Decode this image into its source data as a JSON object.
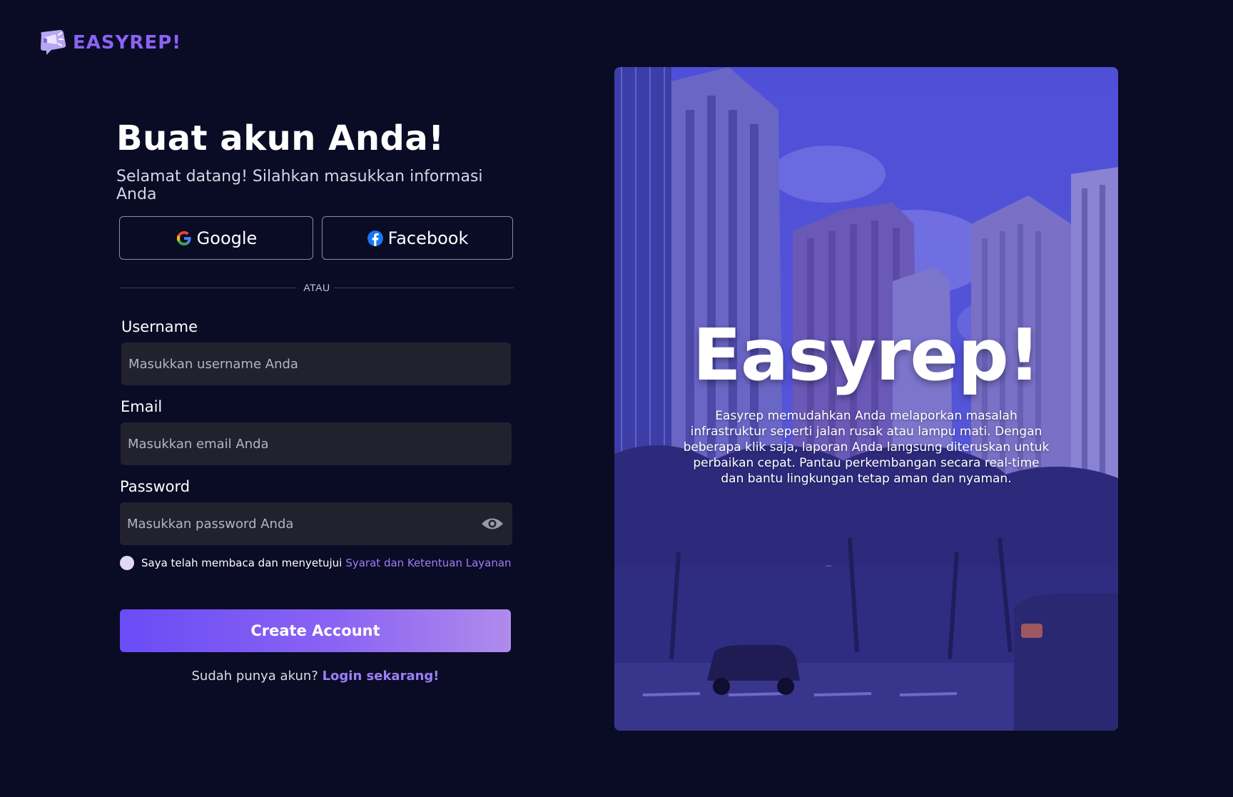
{
  "brand": {
    "name": "EASYREP!",
    "color": "#8a63f3"
  },
  "form": {
    "title": "Buat akun Anda!",
    "subtitle": "Selamat datang! Silahkan masukkan informasi Anda",
    "google_label": "Google",
    "facebook_label": "Facebook",
    "divider_text": "ATAU",
    "username": {
      "label": "Username",
      "placeholder": "Masukkan username Anda"
    },
    "email": {
      "label": "Email",
      "placeholder": "Masukkan email Anda"
    },
    "password": {
      "label": "Password",
      "placeholder": "Masukkan password Anda"
    },
    "terms_text": "Saya telah membaca dan menyetujui",
    "terms_link": "Syarat dan Ketentuan Layanan",
    "submit_label": "Create Account",
    "login_question": "Sudah punya akun?",
    "login_link": "Login sekarang!"
  },
  "hero": {
    "title": "Easyrep!",
    "description": "Easyrep memudahkan Anda melaporkan masalah infrastruktur seperti jalan rusak atau lampu mati. Dengan beberapa klik saja, laporan Anda langsung diteruskan untuk perbaikan cepat. Pantau perkembangan secara real-time dan bantu lingkungan tetap aman dan nyaman."
  },
  "icons": {
    "logo": "megaphone-chat-icon",
    "google": "google-icon",
    "facebook": "facebook-icon",
    "password_toggle": "eye-icon"
  },
  "colors": {
    "background": "#0a0b25",
    "field": "#22222f",
    "accent": "#8a63f3",
    "link": "#9d7ff5"
  }
}
